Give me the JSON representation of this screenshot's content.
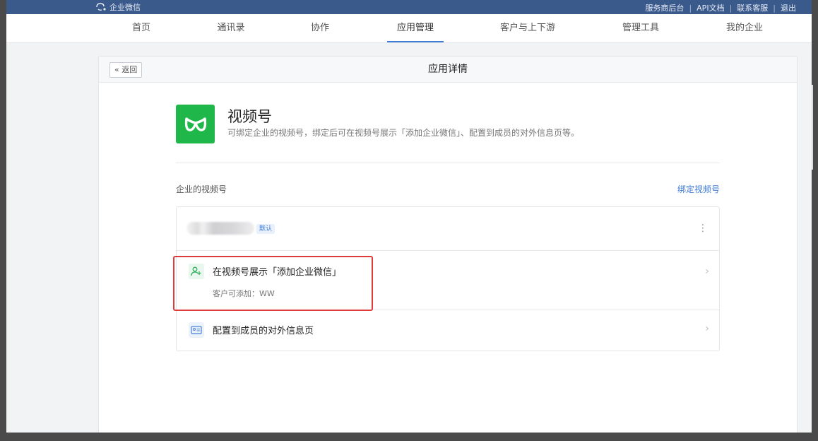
{
  "topbar": {
    "logo_text": "企业微信",
    "links": [
      "服务商后台",
      "API文档",
      "联系客服",
      "退出"
    ],
    "separator": "|"
  },
  "nav": {
    "items": [
      "首页",
      "通讯录",
      "协作",
      "应用管理",
      "客户与上下游",
      "管理工具",
      "我的企业"
    ],
    "active": "应用管理"
  },
  "page": {
    "back_label": "« 返回",
    "title": "应用详情"
  },
  "app": {
    "name": "视频号",
    "description": "可绑定企业的视频号，绑定后可在视频号展示「添加企业微信」、配置到成员的对外信息页等。",
    "icon": "channels-logo-icon",
    "icon_color": "#1fb74a"
  },
  "section": {
    "label": "企业的视频号",
    "bind_link": "绑定视频号"
  },
  "list": {
    "account": {
      "default_badge": "默认",
      "more_icon": "⋮"
    },
    "items": [
      {
        "title": "在视频号展示「添加企业微信」",
        "subtitle": "客户可添加：WW",
        "icon": "add-contact-icon"
      },
      {
        "title": "配置到成员的对外信息页",
        "icon": "id-card-icon"
      }
    ],
    "chevron": "›"
  },
  "colors": {
    "accent": "#3f7bd5",
    "highlight": "#e03b3b",
    "topbar": "#3a5a8c"
  }
}
